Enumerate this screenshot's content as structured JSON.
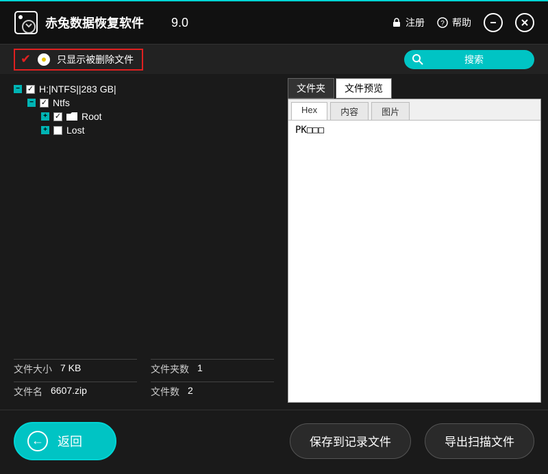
{
  "header": {
    "title": "赤兔数据恢复软件",
    "version": "9.0",
    "register": "注册",
    "help": "帮助"
  },
  "toolbar": {
    "filter_label": "只显示被删除文件",
    "search_label": "搜索"
  },
  "tree": {
    "root": "H:|NTFS||283 GB|",
    "ntfs": "Ntfs",
    "root_folder": "Root",
    "lost": "Lost"
  },
  "stats": {
    "size_label": "文件大小",
    "size_value": "7 KB",
    "folders_label": "文件夹数",
    "folders_value": "1",
    "name_label": "文件名",
    "name_value": "6607.zip",
    "files_label": "文件数",
    "files_value": "2"
  },
  "outer_tabs": {
    "folder": "文件夹",
    "preview": "文件预览"
  },
  "inner_tabs": {
    "hex": "Hex",
    "content": "内容",
    "image": "图片"
  },
  "preview": {
    "content": "PK□□□"
  },
  "footer": {
    "back": "返回",
    "save": "保存到记录文件",
    "export": "导出扫描文件"
  }
}
